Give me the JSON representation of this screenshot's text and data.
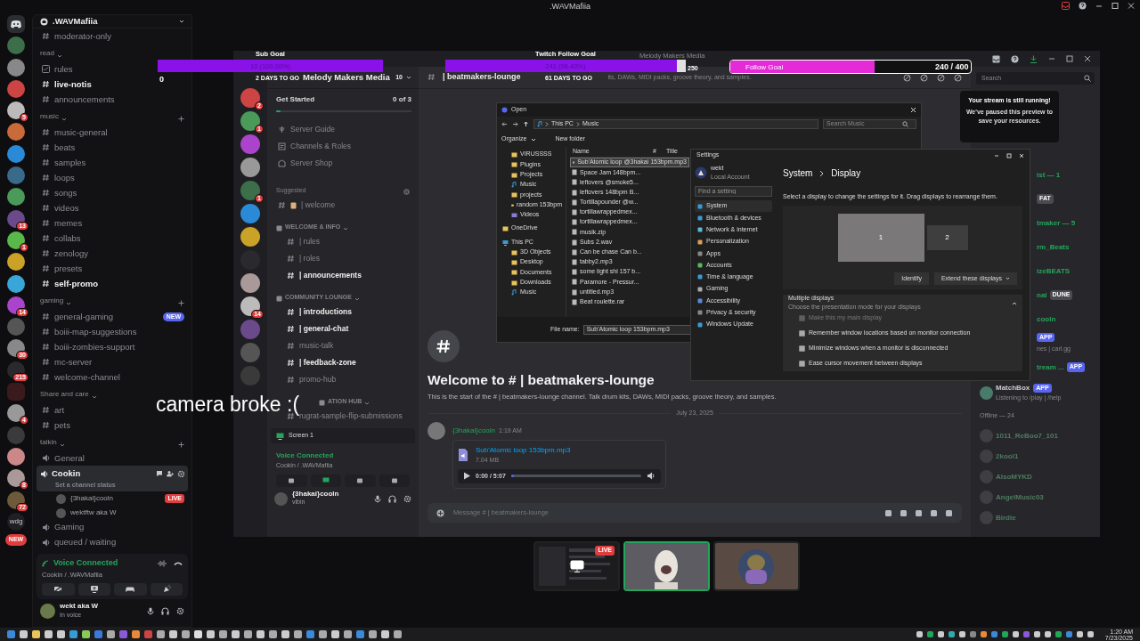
{
  "title_bar": {
    "title": ".WAVMafiia"
  },
  "servers": [
    {
      "kind": "home"
    },
    {
      "kind": "server"
    },
    {
      "kind": "server"
    },
    {
      "kind": "server"
    },
    {
      "kind": "server",
      "badge": "5"
    },
    {
      "kind": "server"
    },
    {
      "kind": "server"
    },
    {
      "kind": "server"
    },
    {
      "kind": "server"
    },
    {
      "kind": "server",
      "badge": "13"
    },
    {
      "kind": "server",
      "badge": "1"
    },
    {
      "kind": "server"
    },
    {
      "kind": "server"
    },
    {
      "kind": "server",
      "badge": "14"
    },
    {
      "kind": "server"
    },
    {
      "kind": "server",
      "badge": "30"
    },
    {
      "kind": "server",
      "badge": "215"
    },
    {
      "kind": "folder"
    },
    {
      "kind": "server",
      "badge": "4"
    },
    {
      "kind": "server"
    },
    {
      "kind": "server"
    },
    {
      "kind": "server",
      "badge": "8"
    },
    {
      "kind": "server",
      "badge": "72"
    },
    {
      "kind": "text",
      "label": "wdg"
    },
    {
      "kind": "new",
      "label": "NEW"
    }
  ],
  "sidebar": {
    "header": ".WAVMafiia",
    "items": [
      {
        "kind": "channel",
        "label": "moderator-only",
        "unread": false
      },
      {
        "kind": "category",
        "label": "read",
        "add": false
      },
      {
        "kind": "rules",
        "label": "rules",
        "unread": false
      },
      {
        "kind": "channel",
        "label": "live-notis",
        "unread": true
      },
      {
        "kind": "channel",
        "label": "announcements",
        "unread": false
      },
      {
        "kind": "category",
        "label": "music",
        "add": true
      },
      {
        "kind": "channel",
        "label": "music-general",
        "unread": false
      },
      {
        "kind": "channel",
        "label": "beats",
        "unread": false
      },
      {
        "kind": "channel",
        "label": "samples",
        "unread": false
      },
      {
        "kind": "channel",
        "label": "loops",
        "unread": false
      },
      {
        "kind": "channel",
        "label": "songs",
        "unread": false
      },
      {
        "kind": "channel",
        "label": "videos",
        "unread": false
      },
      {
        "kind": "channel",
        "label": "memes",
        "unread": false
      },
      {
        "kind": "channel",
        "label": "collabs",
        "unread": false
      },
      {
        "kind": "channel",
        "label": "zenology",
        "unread": false
      },
      {
        "kind": "channel",
        "label": "presets",
        "unread": false
      },
      {
        "kind": "channel",
        "label": "self-promo",
        "unread": true
      },
      {
        "kind": "category",
        "label": "gaming",
        "add": true
      },
      {
        "kind": "channel",
        "label": "general-gaming",
        "unread": false,
        "badge": "NEW"
      },
      {
        "kind": "channel",
        "label": "boiii-map-suggestions",
        "unread": false
      },
      {
        "kind": "channel",
        "label": "boiii-zombies-support",
        "unread": false
      },
      {
        "kind": "channel",
        "label": "mc-server",
        "unread": false
      },
      {
        "kind": "channel",
        "label": "welcome-channel",
        "unread": false
      },
      {
        "kind": "category",
        "label": "Share and care",
        "add": false
      },
      {
        "kind": "channel",
        "label": "art",
        "unread": false
      },
      {
        "kind": "channel",
        "label": "pets",
        "unread": false
      },
      {
        "kind": "category",
        "label": "talkin",
        "add": true
      },
      {
        "kind": "voice",
        "label": "General",
        "selected": false
      },
      {
        "kind": "voice",
        "label": "Cookin",
        "selected": true,
        "status": "Set a channel status",
        "children": [
          {
            "name": "{3hakai}cooln",
            "tag": "LIVE"
          },
          {
            "name": "wektftw aka W"
          }
        ]
      },
      {
        "kind": "voice",
        "label": "Gaming",
        "selected": false
      },
      {
        "kind": "voice",
        "label": "queued / waiting",
        "selected": false
      }
    ]
  },
  "voice_panel": {
    "status": "Voice Connected",
    "location": "Cookin / .WAVMafiia"
  },
  "user_panel": {
    "name": "wekt aka W",
    "status": "In voice"
  },
  "overlays": [
    {
      "kind": "bar",
      "title": "Sub Goal",
      "reading": "10 (100.00%)",
      "level": 1.0,
      "start": "0"
    },
    {
      "kind": "bar",
      "title": "Twitch Follow Goal",
      "reading": "241 (96.40%)",
      "level": 0.964,
      "end": "250"
    },
    {
      "kind": "pill",
      "title": "Follow Goal",
      "reading": "240 / 400",
      "level": 0.6
    }
  ],
  "countdowns": [
    "2 DAYS TO GO",
    "61 DAYS TO GO"
  ],
  "camera_note": "camera broke :(",
  "stream": {
    "window_title": "Melody Makers Media",
    "rail": [
      {
        "kind": "server",
        "badge": "2"
      },
      {
        "kind": "server",
        "badge": "1"
      },
      {
        "kind": "server"
      },
      {
        "kind": "server"
      },
      {
        "kind": "server",
        "badge": "1"
      },
      {
        "kind": "server"
      },
      {
        "kind": "server"
      },
      {
        "kind": "server"
      },
      {
        "kind": "server"
      },
      {
        "kind": "server",
        "badge": "14"
      },
      {
        "kind": "server"
      },
      {
        "kind": "server"
      },
      {
        "kind": "server"
      }
    ],
    "server_header": "Melody Makers Media",
    "server_count": "10",
    "get_started": {
      "title": "Get Started",
      "progress": "0 of 3",
      "level": 0.03
    },
    "guide_items": [
      "Server Guide",
      "Channels & Roles",
      "Server Shop"
    ],
    "suggested": {
      "label": "Suggested",
      "channel": "| welcome"
    },
    "groups": [
      {
        "name": "WELCOME & INFO",
        "channels": [
          {
            "label": "| rules",
            "unread": false
          },
          {
            "label": "| roles",
            "unread": false
          },
          {
            "label": "| announcements",
            "unread": true
          }
        ]
      },
      {
        "name": "COMMUNITY LOUNGE",
        "channels": [
          {
            "label": "| introductions",
            "unread": true
          },
          {
            "label": "| general-chat",
            "unread": true
          },
          {
            "label": "music-talk",
            "unread": false
          },
          {
            "label": "| feedback-zone",
            "unread": true
          },
          {
            "label": "promo-hub",
            "unread": false
          }
        ]
      },
      {
        "name": "ATION HUB",
        "channels": [
          {
            "label": "rugrat-sample-flip-submissions",
            "unread": false
          }
        ]
      }
    ],
    "screen_share": "Screen 1",
    "voice": {
      "status": "Voice Connected",
      "location": "Cookin / .WAVMafiia"
    },
    "user": {
      "name": "{3hakai}cooln",
      "status": "vibin"
    },
    "channel": "| beatmakers-lounge",
    "topic": "its, DAWs, MIDI packs, groove theory, and samples.",
    "welcome_title": "Welcome to # | beatmakers-lounge",
    "welcome_text": "This is the start of the # | beatmakers-lounge channel. Talk drum kits, DAWs, MIDI packs, groove theory, and samples.",
    "date": "July 23, 2025",
    "message": {
      "author": "{3hakai}cooln",
      "time": "1:19 AM",
      "file": "Sub'Atomic loop 153bpm.mp3",
      "size": "7.04 MB",
      "reading": "0:00 / 5:07",
      "level": 0.02
    },
    "input": {
      "placeholder": "Message # | beatmakers-lounge"
    },
    "search": {
      "placeholder": "Search"
    },
    "toast": {
      "title": "Your stream is still running!",
      "body": "We've paused this preview to save your resources."
    },
    "members": [
      {
        "kind": "partial",
        "label": "ist — 1"
      },
      {
        "kind": "partial",
        "tag": "FAT"
      },
      {
        "kind": "partial",
        "label": "tmaker — 5"
      },
      {
        "kind": "partial",
        "label": "rm_Beats"
      },
      {
        "kind": "partial",
        "label": "izeBEATS"
      },
      {
        "kind": "partial",
        "label": "nal",
        "tag": "DUNE"
      },
      {
        "kind": "partial",
        "label": "cooln"
      },
      {
        "kind": "partial",
        "tag": "APP",
        "sub": "nes | carl.gg"
      },
      {
        "kind": "partial",
        "label": "tream ...",
        "tag": "APP"
      },
      {
        "kind": "member",
        "label": "MatchBox",
        "tag": "APP",
        "sub": "Listening to /play | /help"
      },
      {
        "kind": "heading",
        "label": "Offline — 24"
      },
      {
        "kind": "offline",
        "label": "1011_ReBoo7_101"
      },
      {
        "kind": "offline",
        "label": "2kool1"
      },
      {
        "kind": "offline",
        "label": "AlsoMYKD"
      },
      {
        "kind": "offline",
        "label": "AngelMusic03"
      },
      {
        "kind": "offline",
        "label": "Birdie"
      }
    ],
    "open_dialog": {
      "title": "Open",
      "path": [
        "This PC",
        "Music"
      ],
      "search": {
        "placeholder": "Search Music"
      },
      "organize": "Organize",
      "new_folder": "New folder",
      "tree": [
        {
          "kind": "folder",
          "label": "VIRUSSSS"
        },
        {
          "kind": "folder",
          "label": "Plugins"
        },
        {
          "kind": "folder",
          "label": "Projects"
        },
        {
          "kind": "music",
          "label": "Music"
        },
        {
          "kind": "folder",
          "label": "projects"
        },
        {
          "kind": "folder",
          "label": "random 153bpm"
        },
        {
          "kind": "video",
          "label": "Videos"
        },
        {
          "kind": "cloud",
          "label": "OneDrive"
        },
        {
          "kind": "pc",
          "label": "This PC"
        },
        {
          "kind": "folder",
          "label": "3D Objects"
        },
        {
          "kind": "folder",
          "label": "Desktop"
        },
        {
          "kind": "folder",
          "label": "Documents"
        },
        {
          "kind": "folder",
          "label": "Downloads"
        },
        {
          "kind": "music",
          "label": "Music"
        }
      ],
      "columns": [
        "Name",
        "#",
        "Title"
      ],
      "files": [
        {
          "label": "Sub'Atomic loop @3hakai 153bpm.mp3",
          "selected": true
        },
        {
          "label": "Space Jam 148bpm...",
          "selected": false
        },
        {
          "label": "leftovers @smoke5...",
          "selected": false
        },
        {
          "label": "leftovers 148bpm B...",
          "selected": false
        },
        {
          "label": "Tortillapounder @w...",
          "selected": false
        },
        {
          "label": "tortillawrappedmex...",
          "selected": false
        },
        {
          "label": "tortillawrappedmex...",
          "selected": false
        },
        {
          "label": "musik.zip",
          "selected": false
        },
        {
          "label": "Subs 2.wav",
          "selected": false
        },
        {
          "label": "Can be chase Can b...",
          "selected": false
        },
        {
          "label": "tabby2.mp3",
          "selected": false
        },
        {
          "label": "some light shi 157 b...",
          "selected": false
        },
        {
          "label": "Paramore - Pressur...",
          "selected": false
        },
        {
          "label": "untitled.mp3",
          "selected": false
        },
        {
          "label": "Beat roulette.rar",
          "selected": false
        }
      ],
      "file_name_label": "File name:",
      "file_name": "Sub'Atomic loop 153bpm.mp3"
    },
    "settings": {
      "title": "Settings",
      "account": "wekt",
      "account_type": "Local Account",
      "find": {
        "placeholder": "Find a setting"
      },
      "nav": [
        {
          "label": "System",
          "selected": true
        },
        {
          "label": "Bluetooth & devices",
          "selected": false
        },
        {
          "label": "Network & internet",
          "selected": false
        },
        {
          "label": "Personalization",
          "selected": false
        },
        {
          "label": "Apps",
          "selected": false
        },
        {
          "label": "Accounts",
          "selected": false
        },
        {
          "label": "Time & language",
          "selected": false
        },
        {
          "label": "Gaming",
          "selected": false
        },
        {
          "label": "Accessibility",
          "selected": false
        },
        {
          "label": "Privacy & security",
          "selected": false
        },
        {
          "label": "Windows Update",
          "selected": false
        }
      ],
      "breadcrumb": [
        "System",
        "Display"
      ],
      "hint": "Select a display to change the settings for it. Drag displays to rearrange them.",
      "displays": [
        {
          "label": "1",
          "selected": true
        },
        {
          "label": "2",
          "selected": false
        }
      ],
      "identify": "Identify",
      "mode": "Extend these displays",
      "section": {
        "title": "Multiple displays",
        "subtitle": "Choose the presentation mode for your displays",
        "expanded": true
      },
      "options": [
        {
          "label": "Make this my main display",
          "checked": true,
          "disabled": true
        },
        {
          "label": "Remember window locations based on monitor connection",
          "checked": true,
          "disabled": false
        },
        {
          "label": "Minimize windows when a monitor is disconnected",
          "checked": true,
          "disabled": false
        },
        {
          "label": "Ease cursor movement between displays",
          "checked": true,
          "disabled": false
        }
      ]
    }
  },
  "thumbnails": [
    {
      "kind": "screen",
      "tag": "LIVE",
      "speaking": false
    },
    {
      "kind": "picture",
      "speaking": true
    },
    {
      "kind": "picture",
      "speaking": false
    }
  ],
  "taskbar": {
    "time": "1:20 AM",
    "date": "7/23/2025"
  }
}
